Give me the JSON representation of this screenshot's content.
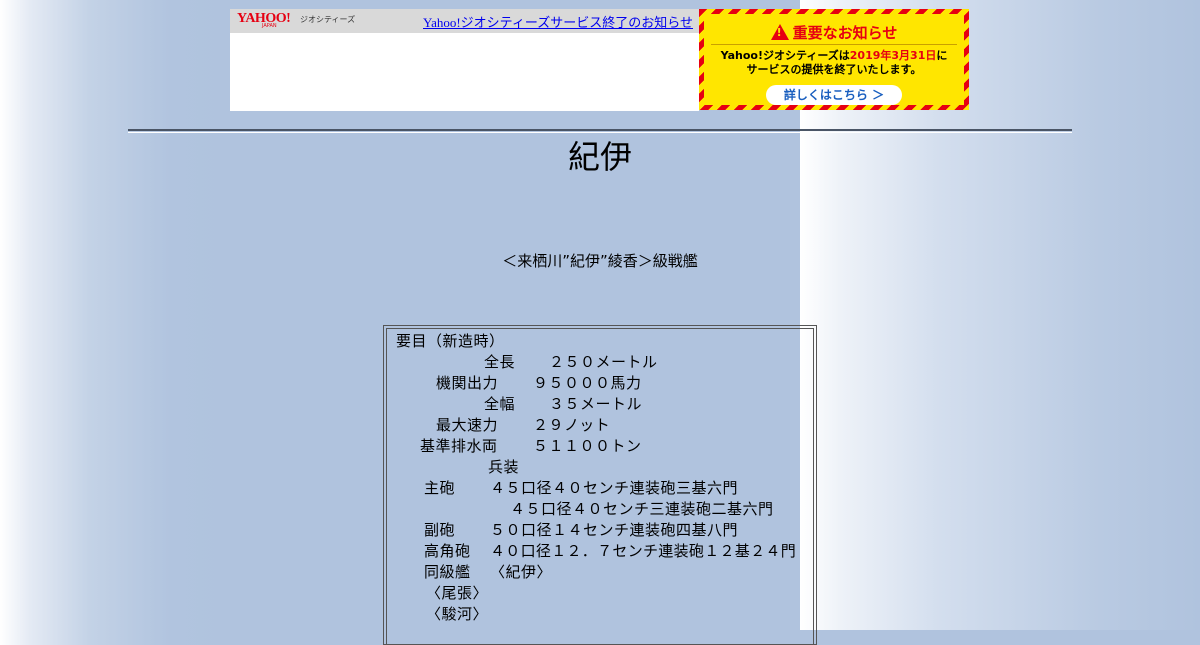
{
  "banner": {
    "logo_text": "YAHOO!",
    "logo_sub": "JAPAN",
    "service_name": "ジオシティーズ",
    "link_text": "Yahoo!ジオシティーズサービス終了のお知らせ"
  },
  "notice": {
    "title": "重要なお知らせ",
    "line1_pre": "Yahoo!ジオシティーズは",
    "line1_date": "2019年3月31日",
    "line1_post": "に",
    "line2": "サービスの提供を終了いたします。",
    "button_label": "詳しくはこちら ＞",
    "colors": {
      "red": "#e60012",
      "yellow": "#ffe600",
      "link_blue": "#1a5fbf"
    }
  },
  "page": {
    "title": "紀伊",
    "subtitle": "＜来栖川”紀伊”綾香＞級戦艦"
  },
  "specs": {
    "heading": "要目（新造時）",
    "length_label": "全長",
    "length_value": "２５０メートル",
    "power_label": "機関出力",
    "power_value": "９５０００馬力",
    "beam_label": "全幅",
    "beam_value": "３５メートル",
    "speed_label": "最大速力",
    "speed_value": "２９ノット",
    "displacement_label": "基準排水両",
    "displacement_value": "５１１００トン",
    "armament_label": "兵装",
    "main_gun_label": "主砲",
    "main_gun_value1": "４５口径４０センチ連装砲三基六門",
    "main_gun_value2": "４５口径４０センチ三連装砲二基六門",
    "secondary_label": "副砲",
    "secondary_value": "５０口径１４センチ連装砲四基八門",
    "aa_label": "高角砲",
    "aa_value": "４０口径１２．７センチ連装砲１２基２４門",
    "class_label": "同級艦",
    "class_item1": "〈紀伊〉",
    "class_item2": "〈尾張〉",
    "class_item3": "〈駿河〉"
  }
}
